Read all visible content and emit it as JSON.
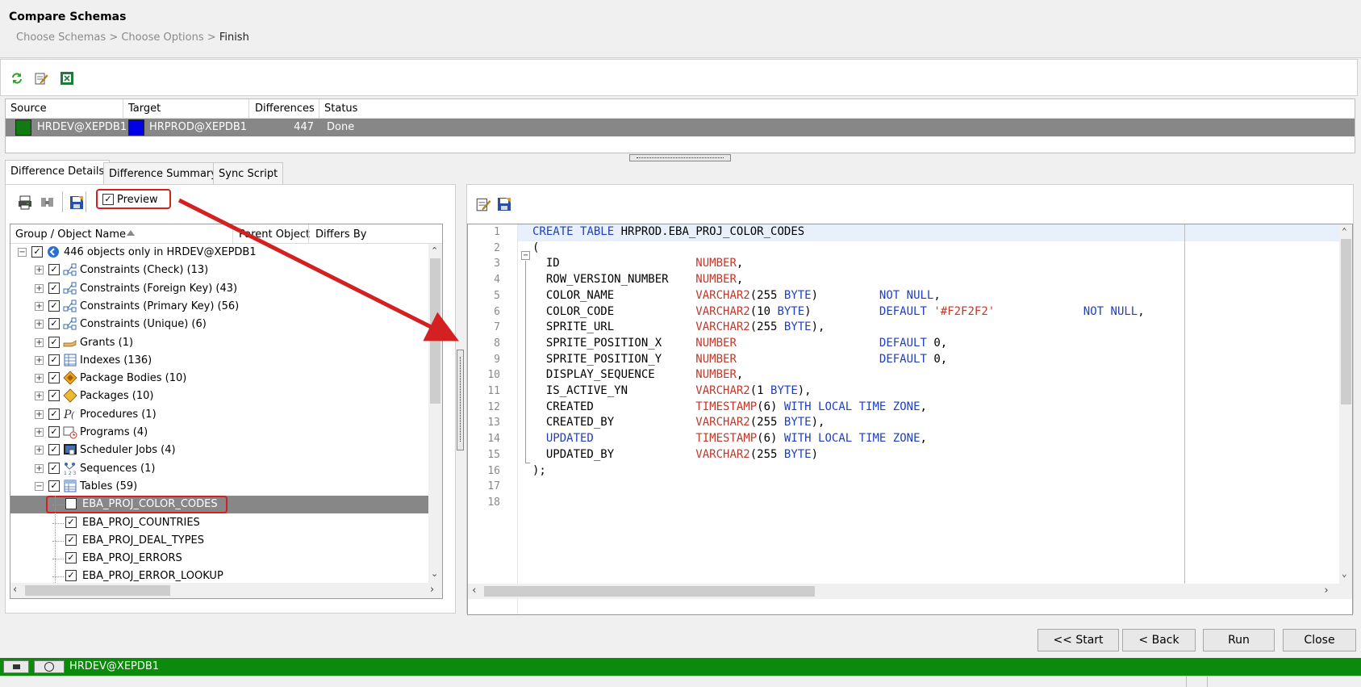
{
  "window": {
    "title": "Compare Schemas",
    "breadcrumb": [
      "Choose Schemas",
      "Choose Options",
      "Finish"
    ]
  },
  "toolbar": {
    "icons": [
      "refresh-icon",
      "edit-icon",
      "excel-export-icon"
    ]
  },
  "comparison_grid": {
    "columns": [
      "Source",
      "Target",
      "Differences",
      "Status"
    ],
    "row": {
      "source": "HRDEV@XEPDB1",
      "source_color": "#117a11",
      "target": "HRPROD@XEPDB1",
      "target_color": "#0000e6",
      "differences": "447",
      "status": "Done"
    }
  },
  "tabs": [
    {
      "label": "Difference Details",
      "active": true
    },
    {
      "label": "Difference Summary",
      "active": false
    },
    {
      "label": "Sync Script",
      "active": false
    }
  ],
  "left_toolbar": {
    "preview_label": "Preview",
    "preview_checked": true
  },
  "tree": {
    "columns": [
      "Group / Object Name",
      "Parent Object",
      "Differs By"
    ],
    "root": "446 objects only in HRDEV@XEPDB1",
    "groups": [
      {
        "label": "Constraints (Check) (13)",
        "icon": "constraint-icon"
      },
      {
        "label": "Constraints (Foreign Key) (43)",
        "icon": "constraint-icon"
      },
      {
        "label": "Constraints (Primary Key) (56)",
        "icon": "constraint-icon"
      },
      {
        "label": "Constraints (Unique) (6)",
        "icon": "constraint-icon"
      },
      {
        "label": "Grants (1)",
        "icon": "grant-icon"
      },
      {
        "label": "Indexes (136)",
        "icon": "index-icon"
      },
      {
        "label": "Package Bodies (10)",
        "icon": "package-body-icon"
      },
      {
        "label": "Packages (10)",
        "icon": "package-icon"
      },
      {
        "label": "Procedures (1)",
        "icon": "procedure-icon"
      },
      {
        "label": "Programs (4)",
        "icon": "program-icon"
      },
      {
        "label": "Scheduler Jobs (4)",
        "icon": "scheduler-job-icon"
      },
      {
        "label": "Sequences (1)",
        "icon": "sequence-icon"
      },
      {
        "label": "Tables (59)",
        "icon": "table-icon"
      }
    ],
    "tables": [
      "EBA_PROJ_COLOR_CODES",
      "EBA_PROJ_COUNTRIES",
      "EBA_PROJ_DEAL_TYPES",
      "EBA_PROJ_ERRORS",
      "EBA_PROJ_ERROR_LOOKUP"
    ],
    "selected": "EBA_PROJ_COLOR_CODES"
  },
  "code": {
    "line_numbers": [
      "1",
      "2",
      "3",
      "4",
      "5",
      "6",
      "7",
      "8",
      "9",
      "10",
      "11",
      "12",
      "13",
      "14",
      "15",
      "16",
      "17",
      "18"
    ],
    "lines": [
      "CREATE TABLE HRPROD.EBA_PROJ_COLOR_CODES",
      "(",
      "  ID                    NUMBER,",
      "  ROW_VERSION_NUMBER    NUMBER,",
      "  COLOR_NAME            VARCHAR2(255 BYTE)         NOT NULL,",
      "  COLOR_CODE            VARCHAR2(10 BYTE)          DEFAULT '#F2F2F2'             NOT NULL,",
      "  SPRITE_URL            VARCHAR2(255 BYTE),",
      "  SPRITE_POSITION_X     NUMBER                     DEFAULT 0,",
      "  SPRITE_POSITION_Y     NUMBER                     DEFAULT 0,",
      "  DISPLAY_SEQUENCE      NUMBER,",
      "  IS_ACTIVE_YN          VARCHAR2(1 BYTE),",
      "  CREATED               TIMESTAMP(6) WITH LOCAL TIME ZONE,",
      "  CREATED_BY            VARCHAR2(255 BYTE),",
      "  UPDATED               TIMESTAMP(6) WITH LOCAL TIME ZONE,",
      "  UPDATED_BY            VARCHAR2(255 BYTE)",
      ");",
      "",
      ""
    ]
  },
  "buttons": {
    "start": "<< Start",
    "back": "< Back",
    "run": "Run",
    "close": "Close"
  },
  "statusbar": {
    "connection": "HRDEV@XEPDB1"
  },
  "colors": {
    "accent_green": "#0b8a0b",
    "selection_gray": "#878787",
    "annotation_red": "#d32020",
    "keyword_blue": "#1f3fbf",
    "type_red": "#c0392b"
  }
}
